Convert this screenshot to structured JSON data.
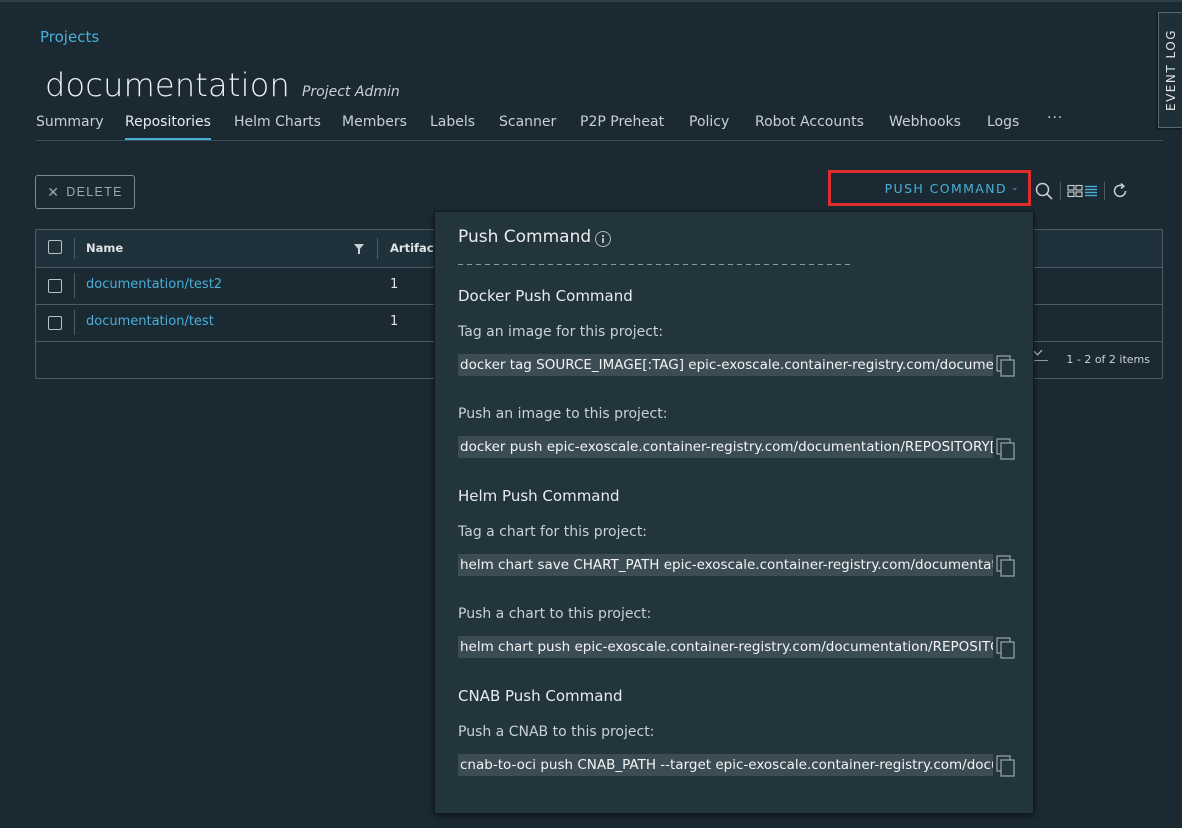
{
  "breadcrumb": {
    "label": "Projects"
  },
  "project": {
    "name": "documentation",
    "role": "Project Admin"
  },
  "tabs": [
    {
      "label": "Summary"
    },
    {
      "label": "Repositories"
    },
    {
      "label": "Helm Charts"
    },
    {
      "label": "Members"
    },
    {
      "label": "Labels"
    },
    {
      "label": "Scanner"
    },
    {
      "label": "P2P Preheat"
    },
    {
      "label": "Policy"
    },
    {
      "label": "Robot Accounts"
    },
    {
      "label": "Webhooks"
    },
    {
      "label": "Logs"
    },
    {
      "label": "···"
    }
  ],
  "event_log": {
    "label": "EVENT LOG"
  },
  "toolbar": {
    "delete_label": "DELETE",
    "push_command_label": "PUSH COMMAND",
    "icons": [
      "search-icon",
      "card-view-icon",
      "list-view-icon",
      "refresh-icon"
    ]
  },
  "table": {
    "columns": [
      "Name",
      "Artifact"
    ],
    "rows": [
      {
        "name": "documentation/test2",
        "artifacts": "1"
      },
      {
        "name": "documentation/test",
        "artifacts": "1"
      }
    ],
    "footer": "1 - 2 of 2 items"
  },
  "push_command": {
    "title": "Push Command",
    "docker": {
      "title": "Docker Push Command",
      "tag_label": "Tag an image for this project:",
      "tag_cmd": "docker tag SOURCE_IMAGE[:TAG] epic-exoscale.container-registry.com/documentation/REPOSITORY[:TAG]",
      "push_label": "Push an image to this project:",
      "push_cmd": "docker push epic-exoscale.container-registry.com/documentation/REPOSITORY[:TAG]"
    },
    "helm": {
      "title": "Helm Push Command",
      "tag_label": "Tag a chart for this project:",
      "tag_cmd": "helm chart save CHART_PATH epic-exoscale.container-registry.com/documentation/REPOSITORY[:TAG]",
      "push_label": "Push a chart to this project:",
      "push_cmd": "helm chart push epic-exoscale.container-registry.com/documentation/REPOSITORY[:TAG]"
    },
    "cnab": {
      "title": "CNAB Push Command",
      "push_label": "Push a CNAB to this project:",
      "push_cmd": "cnab-to-oci push CNAB_PATH --target epic-exoscale.container-registry.com/documentation/REPOSITORY[:TAG]"
    }
  },
  "colors": {
    "accent": "#49afd9",
    "background": "#1b2a32",
    "highlight": "#e02d2d"
  }
}
